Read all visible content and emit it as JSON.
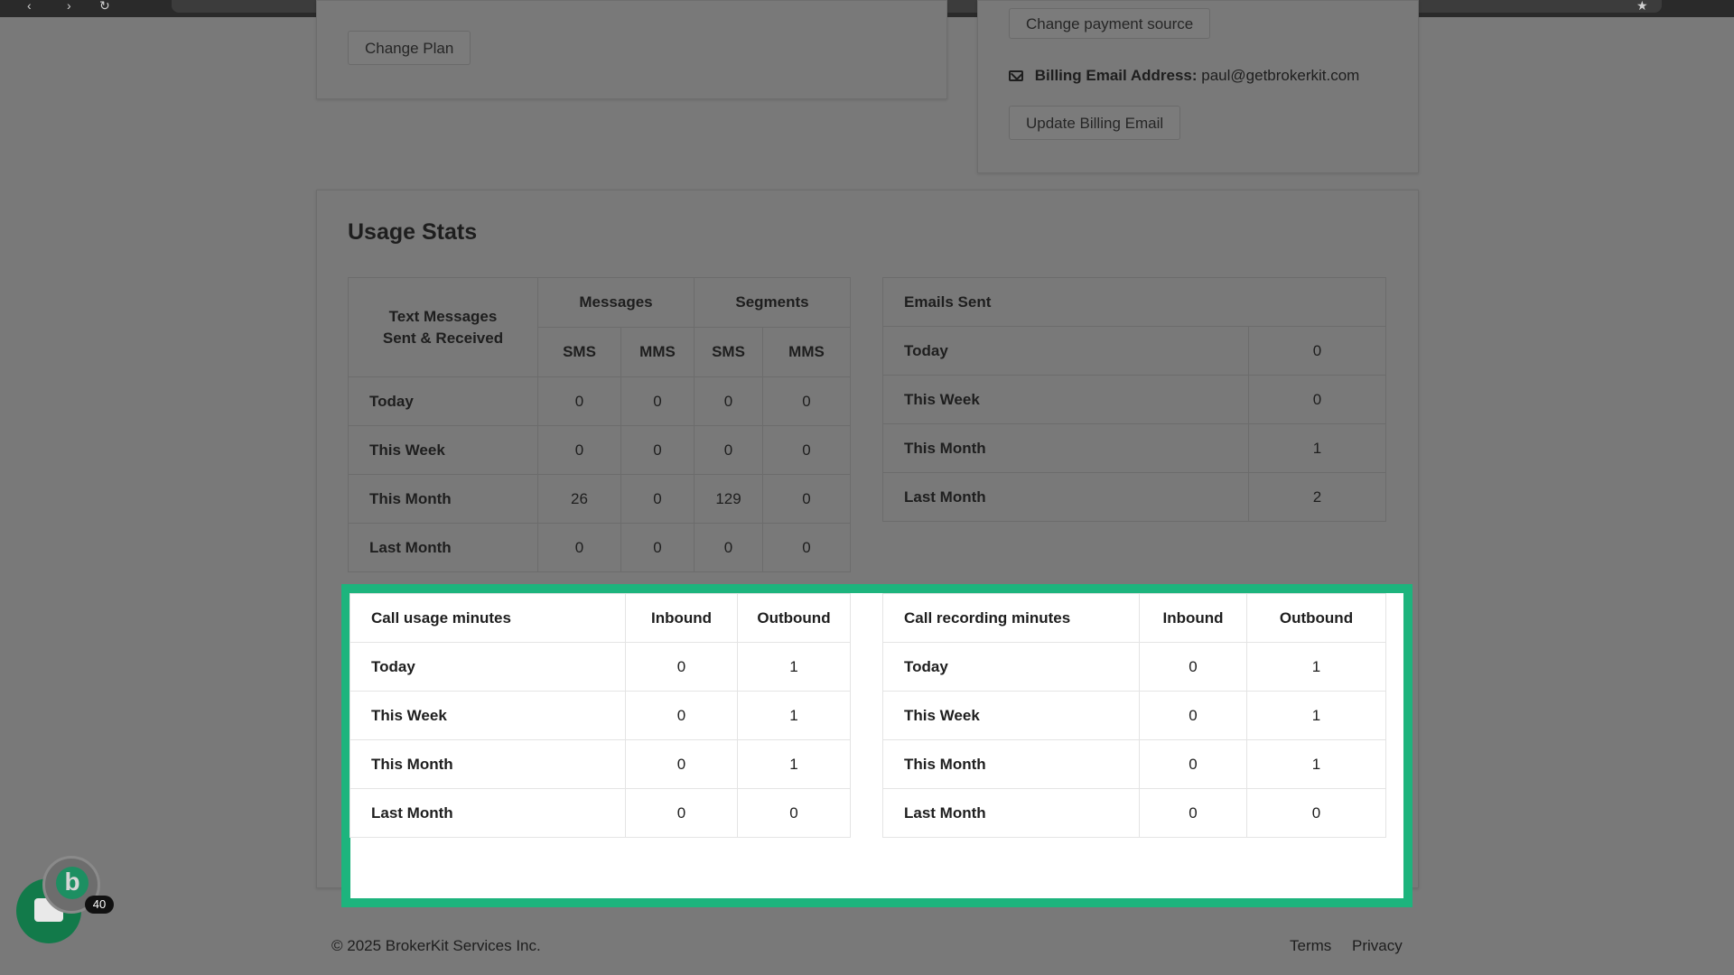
{
  "billing": {
    "change_plan": "Change Plan",
    "change_payment_source": "Change payment source",
    "email_label": "Billing Email Address:",
    "email_value": "paul@getbrokerkit.com",
    "update_email": "Update Billing Email"
  },
  "usage": {
    "title": "Usage Stats",
    "text_table": {
      "corner_line1": "Text Messages",
      "corner_line2": "Sent & Received",
      "group_messages": "Messages",
      "group_segments": "Segments",
      "sub": [
        "SMS",
        "MMS",
        "SMS",
        "MMS"
      ],
      "rows": [
        {
          "label": "Today",
          "values": [
            "0",
            "0",
            "0",
            "0"
          ]
        },
        {
          "label": "This Week",
          "values": [
            "0",
            "0",
            "0",
            "0"
          ]
        },
        {
          "label": "This Month",
          "values": [
            "26",
            "0",
            "129",
            "0"
          ]
        },
        {
          "label": "Last Month",
          "values": [
            "0",
            "0",
            "0",
            "0"
          ]
        }
      ]
    },
    "email_table": {
      "header": "Emails Sent",
      "rows": [
        {
          "label": "Today",
          "value": "0"
        },
        {
          "label": "This Week",
          "value": "0"
        },
        {
          "label": "This Month",
          "value": "1"
        },
        {
          "label": "Last Month",
          "value": "2"
        }
      ]
    },
    "call_table": {
      "header": "Call usage minutes",
      "col_in": "Inbound",
      "col_out": "Outbound",
      "rows": [
        {
          "label": "Today",
          "inbound": "0",
          "outbound": "1"
        },
        {
          "label": "This Week",
          "inbound": "0",
          "outbound": "1"
        },
        {
          "label": "This Month",
          "inbound": "0",
          "outbound": "1"
        },
        {
          "label": "Last Month",
          "inbound": "0",
          "outbound": "0"
        }
      ]
    },
    "recording_table": {
      "header": "Call recording minutes",
      "col_in": "Inbound",
      "col_out": "Outbound",
      "rows": [
        {
          "label": "Today",
          "inbound": "0",
          "outbound": "1"
        },
        {
          "label": "This Week",
          "inbound": "0",
          "outbound": "1"
        },
        {
          "label": "This Month",
          "inbound": "0",
          "outbound": "1"
        },
        {
          "label": "Last Month",
          "inbound": "0",
          "outbound": "0"
        }
      ]
    }
  },
  "footer": {
    "copyright": "© 2025 BrokerKit Services Inc.",
    "terms": "Terms",
    "privacy": "Privacy"
  },
  "widget": {
    "brand_letter": "b",
    "badge_count": "40"
  },
  "colors": {
    "highlight": "#1db47d",
    "overlay": "#797979",
    "brand_green": "#1d8f62"
  },
  "icons": [
    "back-icon",
    "forward-icon",
    "reload-icon",
    "mail-icon",
    "chat-icon",
    "bookmark-icon"
  ]
}
